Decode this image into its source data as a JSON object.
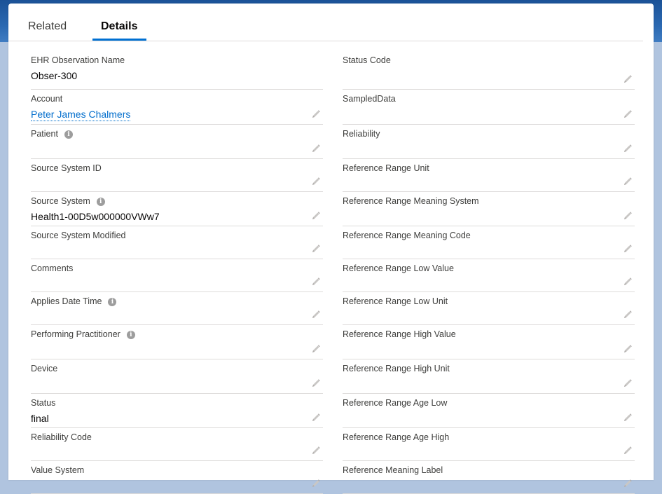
{
  "tabs": [
    {
      "label": "Related",
      "active": false
    },
    {
      "label": "Details",
      "active": true
    }
  ],
  "accent_color": "#0070d2",
  "link_color": "#006dcc",
  "left_fields": [
    {
      "label": "EHR Observation Name",
      "value": "Obser-300",
      "info": false,
      "editable": false
    },
    {
      "label": "Account",
      "value": "Peter James Chalmers",
      "info": false,
      "editable": true,
      "link": true
    },
    {
      "label": "Patient",
      "value": "",
      "info": true,
      "editable": true
    },
    {
      "label": "Source System ID",
      "value": "",
      "info": false,
      "editable": true
    },
    {
      "label": "Source System",
      "value": "Health1-00D5w000000VWw7",
      "info": true,
      "editable": true
    },
    {
      "label": "Source System Modified",
      "value": "",
      "info": false,
      "editable": true
    },
    {
      "label": "Comments",
      "value": "",
      "info": false,
      "editable": true
    },
    {
      "label": "Applies Date Time",
      "value": "",
      "info": true,
      "editable": true
    },
    {
      "label": "Performing Practitioner",
      "value": "",
      "info": true,
      "editable": true
    },
    {
      "label": "Device",
      "value": "",
      "info": false,
      "editable": true
    },
    {
      "label": "Status",
      "value": "final",
      "info": false,
      "editable": true
    },
    {
      "label": "Reliability Code",
      "value": "",
      "info": false,
      "editable": true
    },
    {
      "label": "Value System",
      "value": "",
      "info": false,
      "editable": true
    }
  ],
  "right_fields": [
    {
      "label": "Status Code",
      "value": "",
      "info": false,
      "editable": true
    },
    {
      "label": "SampledData",
      "value": "",
      "info": false,
      "editable": true
    },
    {
      "label": "Reliability",
      "value": "",
      "info": false,
      "editable": true
    },
    {
      "label": "Reference Range Unit",
      "value": "",
      "info": false,
      "editable": true
    },
    {
      "label": "Reference Range Meaning System",
      "value": "",
      "info": false,
      "editable": true
    },
    {
      "label": "Reference Range Meaning Code",
      "value": "",
      "info": false,
      "editable": true
    },
    {
      "label": "Reference Range Low Value",
      "value": "",
      "info": false,
      "editable": true
    },
    {
      "label": "Reference Range Low Unit",
      "value": "",
      "info": false,
      "editable": true
    },
    {
      "label": "Reference Range High Value",
      "value": "",
      "info": false,
      "editable": true
    },
    {
      "label": "Reference Range High Unit",
      "value": "",
      "info": false,
      "editable": true
    },
    {
      "label": "Reference Range Age Low",
      "value": "",
      "info": false,
      "editable": true
    },
    {
      "label": "Reference Range Age High",
      "value": "",
      "info": false,
      "editable": true
    },
    {
      "label": "Reference Meaning Label",
      "value": "",
      "info": false,
      "editable": true
    }
  ]
}
